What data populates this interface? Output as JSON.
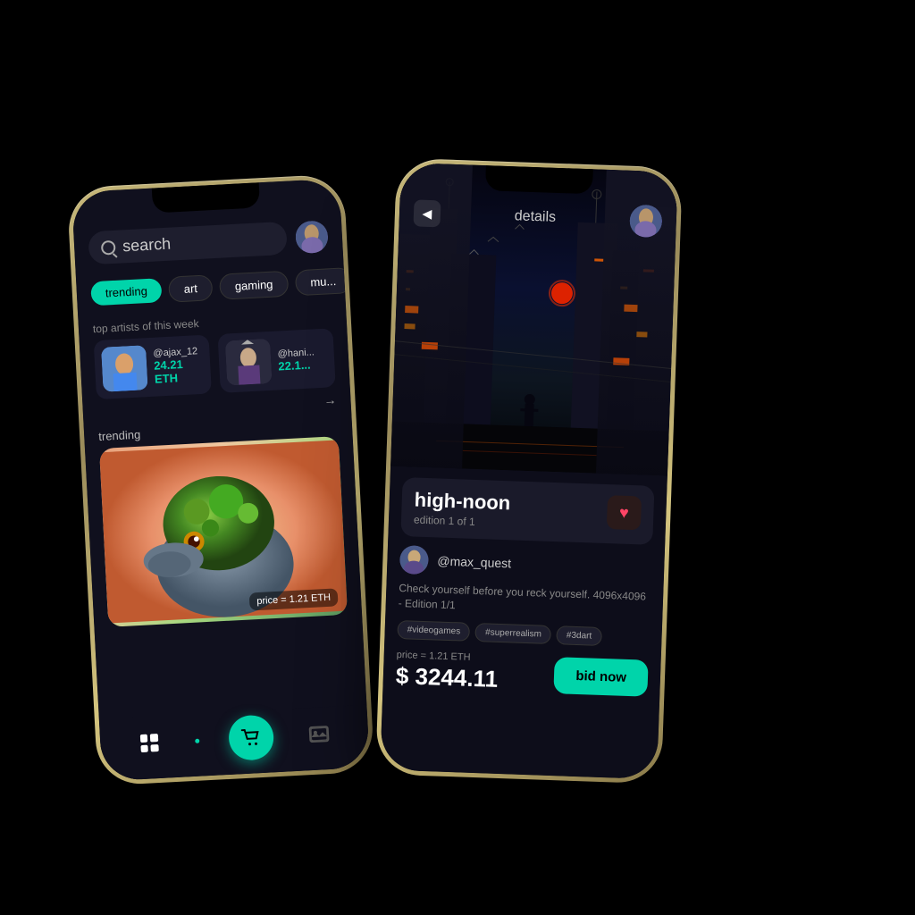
{
  "scene": {
    "background": "#000000"
  },
  "phone_left": {
    "screen": "search",
    "header": {
      "search_placeholder": "search",
      "avatar_label": "user-avatar"
    },
    "categories": [
      {
        "label": "trending",
        "active": true
      },
      {
        "label": "art",
        "active": false
      },
      {
        "label": "gaming",
        "active": false
      },
      {
        "label": "mu...",
        "active": false
      }
    ],
    "section_artists_title": "top artists of this week",
    "artists": [
      {
        "handle": "@ajax_12",
        "eth": "24.21 ETH"
      },
      {
        "handle": "@hani...",
        "eth": "22.1..."
      }
    ],
    "section_trending_title": "trending",
    "trending_item": {
      "price": "price = 1.21 ETH"
    },
    "nav": {
      "cart_visible": true
    }
  },
  "phone_right": {
    "screen": "details",
    "header": {
      "back_label": "◀",
      "title": "details",
      "avatar_label": "user-avatar"
    },
    "nft": {
      "title": "high-noon",
      "edition": "edition 1 of 1",
      "creator": "@max_quest",
      "description": "Check yourself before you reck yourself. 4096x4096 - Edition 1/1",
      "tags": [
        "#videogames",
        "#superrealism",
        "#3dart"
      ],
      "price_label": "price = 1.21 ETH",
      "price_value": "$ 3244.11",
      "bid_label": "bid now"
    }
  }
}
